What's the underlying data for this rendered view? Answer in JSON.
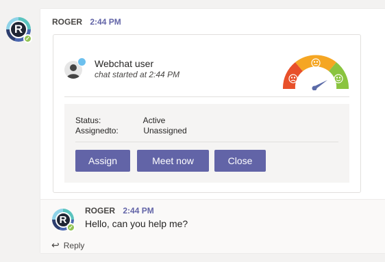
{
  "message": {
    "sender": "ROGER",
    "time": "2:44 PM",
    "avatar_letter": "R"
  },
  "card": {
    "title": "Webchat user",
    "subtitle": "chat started at 2:44 PM",
    "gauge": {
      "colors": [
        "#e8502a",
        "#f5a623",
        "#8ac43f"
      ],
      "needle_color": "#5b6ba8"
    },
    "status_label": "Status:",
    "status_value": "Active",
    "assigned_label": "Assignedto:",
    "assigned_value": "Unassigned",
    "buttons": {
      "assign": "Assign",
      "meet": "Meet now",
      "close": "Close"
    },
    "accent": "#6264a7"
  },
  "reply": {
    "sender": "ROGER",
    "time": "2:44 PM",
    "text": "Hello, can you help me?",
    "avatar_letter": "R",
    "reply_label": "Reply"
  }
}
